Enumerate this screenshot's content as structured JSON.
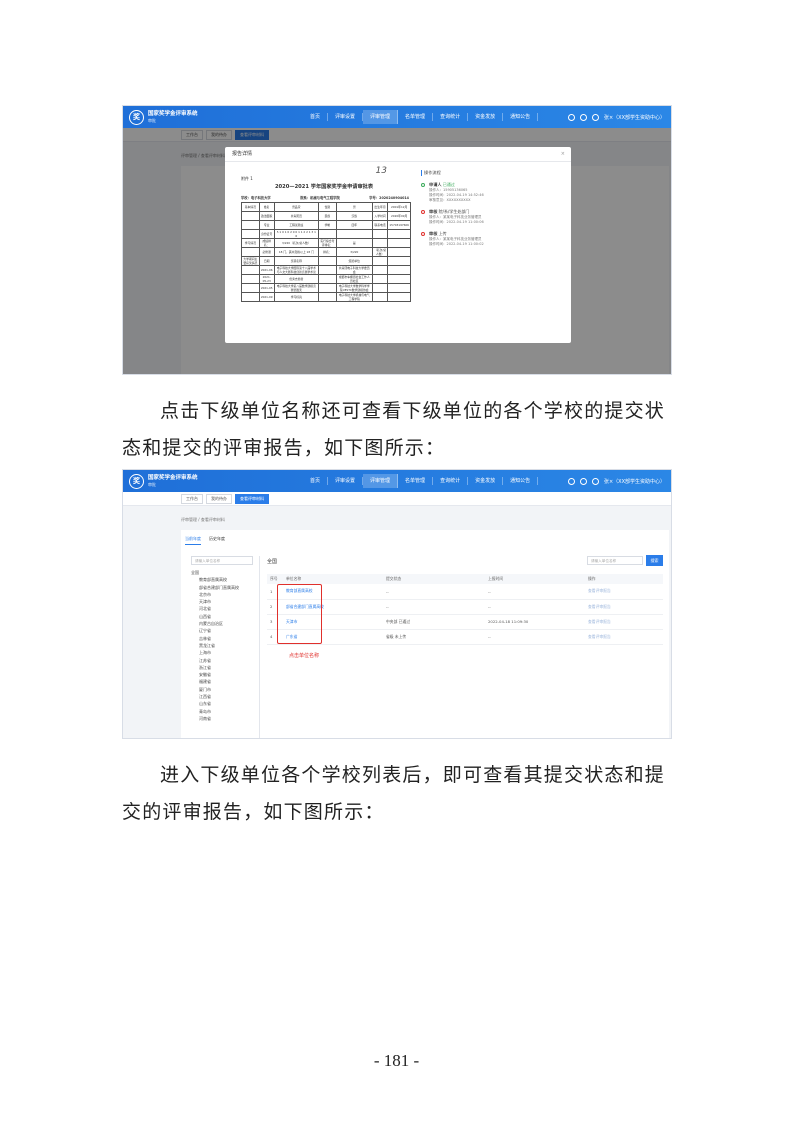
{
  "app": {
    "name": "国家奖学金评审系统",
    "subtitle": "审批",
    "logo_glyph": "奖",
    "nav": [
      "首页",
      "评审设置",
      "评审管理",
      "名单管理",
      "查询统计",
      "资金发放",
      "通知公告"
    ],
    "active_nav": "评审管理",
    "user": "张×（XX部学生资助中心）",
    "tabs": [
      "工作台",
      "我的待办",
      "查看评审材料"
    ]
  },
  "shot1": {
    "breadcrumb": "评审管理 / 查看评审材料",
    "modal_title": "报告详情",
    "modal_close": "×",
    "doc": {
      "fujian": "附件 1",
      "hand": "13",
      "title": "2020—2021 学年国家奖学金申请审批表",
      "school": "学校：电子科技大学",
      "college": "院系：机械与电气工程学院",
      "student_no": "学号：2020240904014"
    },
    "form_rows": [
      [
        "基本情况",
        "姓名",
        "曾品萱",
        "性别",
        "男",
        "出生年月",
        "2001年12月"
      ],
      [
        "",
        "政治面貌",
        "共青团员",
        "民族",
        "汉族",
        "入学时间",
        "2020年09月"
      ],
      [
        "",
        "专业",
        "工程试验班",
        "学制",
        "四年",
        "联系电话",
        "15703197606"
      ],
      [
        "",
        "身份证号",
        "5 1 0 1 0 2 0 0 1 1 2 2 1 3 1 6",
        "",
        "",
        "",
        ""
      ],
      [
        "学习情况",
        "成绩排名：",
        "3/220（名次/总人数）",
        "实行综合考评排名：",
        "是",
        "",
        ""
      ],
      [
        "",
        "必修课",
        "18 门，其中及格以上 18 门",
        "排名：",
        "3/220",
        "（名次/总人数）",
        ""
      ],
      [
        "大学期间主要获奖情况",
        "日期",
        "奖项名称",
        "",
        "颁奖单位",
        "",
        ""
      ],
      [
        "",
        "2021-06",
        "电子科技大学国际第十八届学术与人文大赛科技创新竞赛学术论",
        "",
        "共青团电子科技大学委员会",
        "",
        ""
      ],
      [
        "",
        "2021-05-23",
        "优秀志愿者",
        "",
        "成都市车棚街社会工作人员社区",
        "",
        ""
      ],
      [
        "",
        "2021-05",
        "电子科技大学第八届数学建模竞赛优胜奖",
        "",
        "电子科技大学数学科学学院UESTC数学建模协会",
        "",
        ""
      ],
      [
        "",
        "2021-09",
        "学习标兵",
        "",
        "电子科技大学机械与电气工程学院",
        "",
        ""
      ]
    ],
    "timeline_header": "操作流程",
    "timeline": [
      {
        "node": "申请人",
        "status": "已通过",
        "lines": [
          "操作人：15905136065",
          "操作时间：2022-04-19 14:52:46",
          "审核意见：XXXXXXXXXX"
        ]
      },
      {
        "node": "审核",
        "status": "院/系/学生处部门",
        "lines": [
          "操作人：某某电子科技业务管理员",
          "操作时间：2022-04-19 11:00:06"
        ]
      },
      {
        "node": "审核",
        "status": "上传",
        "lines": [
          "操作人：某某电子科技业务管理员",
          "操作时间：2022-04-19 11:00:02"
        ]
      }
    ]
  },
  "shot2": {
    "breadcrumb": "评审管理 / 查看评审材料",
    "panel_tabs": [
      "当前年度",
      "历史年度"
    ],
    "tree_search_placeholder": "请输入单位名称",
    "tree": [
      "全国",
      "教育部直属高校",
      "部省合建部门直属高校",
      "北京市",
      "天津市",
      "河北省",
      "山西省",
      "内蒙古自治区",
      "辽宁省",
      "吉林省",
      "黑龙江省",
      "上海市",
      "江苏省",
      "浙江省",
      "安徽省",
      "福建省",
      "厦门市",
      "江西省",
      "山东省",
      "青岛市",
      "河南省"
    ],
    "content_title": "全国",
    "top_search_placeholder": "请输入单位名称",
    "search_button": "搜索",
    "columns": [
      "序号",
      "单位名称",
      "提交状态",
      "上报时间",
      "操作"
    ],
    "rows": [
      {
        "no": "1",
        "name": "教育部直属高校",
        "status": "--",
        "time": "--",
        "op": "查看评审报告"
      },
      {
        "no": "2",
        "name": "部省合建部门直属高校",
        "status": "--",
        "time": "--",
        "op": "查看评审报告"
      },
      {
        "no": "3",
        "name": "天津市",
        "status": "中央部 已通过",
        "time": "2022-04-18 11:09:30",
        "op": "查看评审报告"
      },
      {
        "no": "4",
        "name": "广东省",
        "status": "省级 未上传",
        "time": "--",
        "op": "查看评审报告"
      }
    ],
    "annotation": "点击单位名称"
  },
  "paragraphs": [
    "点击下级单位名称还可查看下级单位的各个学校的提交状态和提交的评审报告，如下图所示：",
    "进入下级单位各个学校列表后，即可查看其提交状态和提交的评审报告，如下图所示："
  ],
  "page_number": "- 181 -"
}
